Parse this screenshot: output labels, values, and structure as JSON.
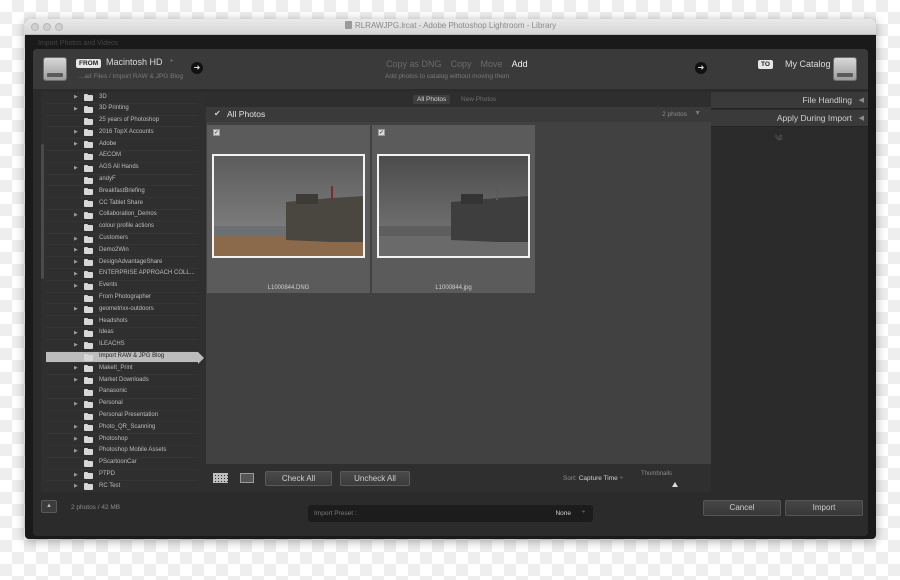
{
  "window": {
    "title": "RLRAWJPG.lrcat - Adobe Photoshop Lightroom - Library",
    "background_title": "Import Photos and Videos"
  },
  "source": {
    "badge": "FROM",
    "name": "Macintosh HD",
    "chevron": "÷",
    "path": "...ad Files / Import RAW & JPG Blog"
  },
  "modes": {
    "items": [
      "Copy as DNG",
      "Copy",
      "Move",
      "Add"
    ],
    "active": "Add",
    "description": "Add photos to catalog without moving them"
  },
  "destination": {
    "badge": "TO",
    "name": "My Catalog"
  },
  "folders": [
    {
      "label": "3D",
      "expand": "▶"
    },
    {
      "label": "3D Printing",
      "expand": "▶"
    },
    {
      "label": "25 years of Photoshop",
      "expand": ""
    },
    {
      "label": "2016 TopX Accounts",
      "expand": "▶"
    },
    {
      "label": "Adobe",
      "expand": "▶"
    },
    {
      "label": "AECOM",
      "expand": ""
    },
    {
      "label": "AGS All Hands",
      "expand": "▶"
    },
    {
      "label": "andyF",
      "expand": ""
    },
    {
      "label": "BreakfastBriefing",
      "expand": ""
    },
    {
      "label": "CC Tablet Share",
      "expand": ""
    },
    {
      "label": "Collaboration_Demos",
      "expand": "▶"
    },
    {
      "label": "colour profile actions",
      "expand": ""
    },
    {
      "label": "Customers",
      "expand": "▶"
    },
    {
      "label": "Demo2Win",
      "expand": "▶"
    },
    {
      "label": "DesignAdvantageShare",
      "expand": "▶"
    },
    {
      "label": "ENTERPRISE APPROACH COLL...",
      "expand": "▶"
    },
    {
      "label": "Events",
      "expand": "▶"
    },
    {
      "label": "From Photographer",
      "expand": ""
    },
    {
      "label": "geometrixx-outdoors",
      "expand": "▶"
    },
    {
      "label": "Headshots",
      "expand": ""
    },
    {
      "label": "Ideas",
      "expand": "▶"
    },
    {
      "label": "ILEACHS",
      "expand": "▶"
    },
    {
      "label": "Import RAW & JPG Blog",
      "expand": "",
      "selected": true
    },
    {
      "label": "MakeIt_Print",
      "expand": "▶"
    },
    {
      "label": "Market Downloads",
      "expand": "▶"
    },
    {
      "label": "Panasonic",
      "expand": ""
    },
    {
      "label": "Personal",
      "expand": "▶"
    },
    {
      "label": "Personal Presentation",
      "expand": ""
    },
    {
      "label": "Photo_QR_Scanning",
      "expand": "▶"
    },
    {
      "label": "Photoshop",
      "expand": "▶"
    },
    {
      "label": "Photoshop Mobile Assets",
      "expand": "▶"
    },
    {
      "label": "PScartoonCar",
      "expand": ""
    },
    {
      "label": "PTPD",
      "expand": "▶"
    },
    {
      "label": "RC Test",
      "expand": "▶"
    }
  ],
  "center": {
    "tabs": [
      {
        "label": "All Photos",
        "active": true
      },
      {
        "label": "New Photos",
        "active": false
      }
    ],
    "header_title": "All Photos",
    "header_count": "2 photos",
    "photos": [
      {
        "filename": "L1000844.DNG",
        "checked": true,
        "tone": "color"
      },
      {
        "filename": "L1000844.jpg",
        "checked": true,
        "tone": "mono"
      }
    ],
    "check_all": "Check All",
    "uncheck_all": "Uncheck All",
    "sort_label": "Sort:",
    "sort_value": "Capture Time",
    "sort_chevron": "÷",
    "thumbnails_label": "Thumbnails"
  },
  "right": {
    "sections": [
      "File Handling",
      "Apply During Import"
    ]
  },
  "footer": {
    "info": "2 photos / 42 MB",
    "preset_label": "Import Preset :",
    "preset_value": "None",
    "preset_chevron": "÷",
    "cancel": "Cancel",
    "import": "Import"
  },
  "colors": {
    "panel_dark": "#2b2b2b",
    "selected_folder": "#bcbcbc",
    "active_mode": "#f0f0f0"
  }
}
